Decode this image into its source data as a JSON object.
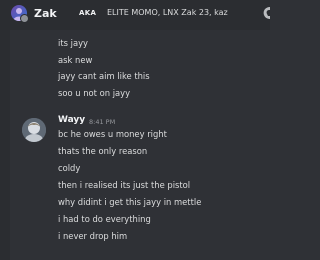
{
  "header": {
    "user_name": "Zak",
    "server_tag": "AKA",
    "group_name": "ELITE MOMO, LNX Zak 23, kaz"
  },
  "messages_above": [
    "its jayy",
    "ask new",
    "jayy cant aim like this",
    "soo u not on jayy"
  ],
  "message_group": {
    "author": "Wayy",
    "timestamp": "8:41 PM",
    "lines": [
      "bc he owes u money right",
      "thats the only reason",
      "coldy",
      "then i realised its just the pistol",
      "why didint i get this jayy in mettle",
      "i had to do everything",
      "i never drop him"
    ]
  },
  "icons": {
    "header_avatar": "user-avatar-icon",
    "call": "phone-call-icon"
  }
}
